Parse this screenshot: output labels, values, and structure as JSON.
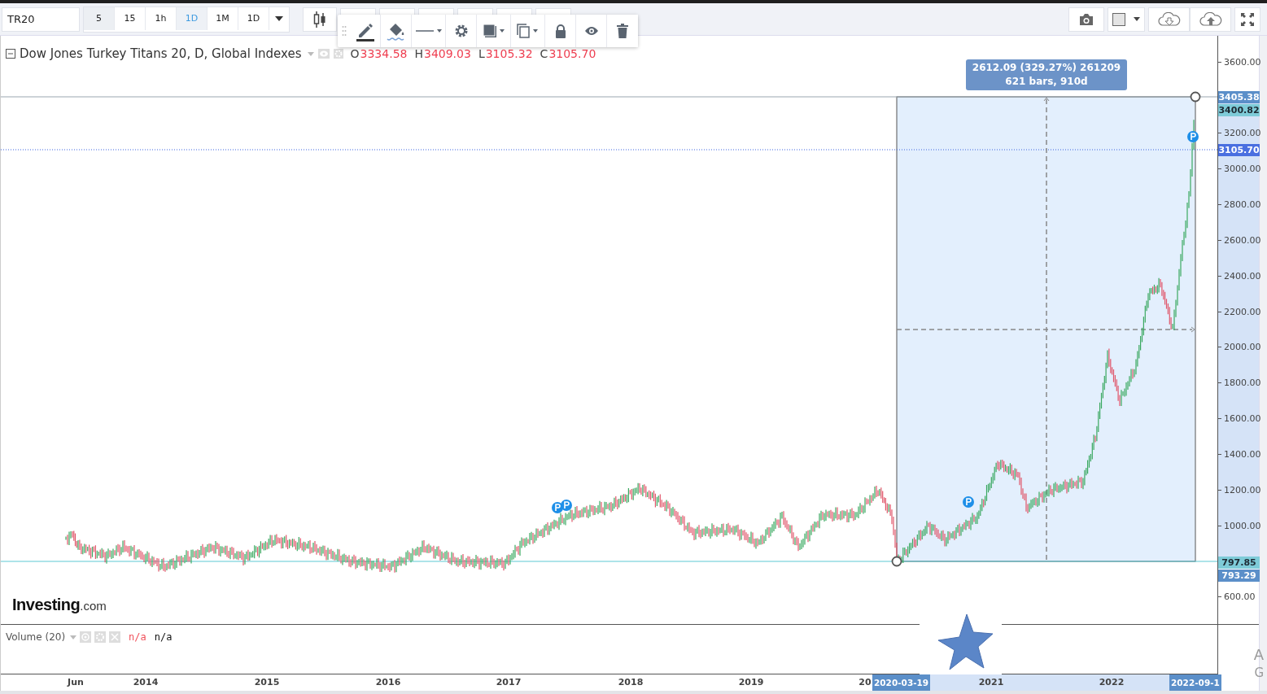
{
  "symbol": {
    "value": "TR20"
  },
  "intervals": [
    {
      "label": "5",
      "selected": false,
      "highlighted": true
    },
    {
      "label": "15",
      "selected": false,
      "highlighted": false
    },
    {
      "label": "1h",
      "selected": false,
      "highlighted": false
    },
    {
      "label": "1D",
      "selected": true,
      "highlighted": false
    },
    {
      "label": "1M",
      "selected": false,
      "highlighted": false
    },
    {
      "label": "1D",
      "selected": false,
      "highlighted": false
    }
  ],
  "legend": {
    "title": "Dow Jones Turkey Titans 20, D, Global Indexes",
    "ohlc": [
      {
        "label": "O",
        "value": "3334.58"
      },
      {
        "label": "H",
        "value": "3409.03"
      },
      {
        "label": "L",
        "value": "3105.32"
      },
      {
        "label": "C",
        "value": "3105.70"
      }
    ]
  },
  "measure": {
    "lines": [
      "2612.09 (329.27%) 261209",
      "621 bars, 910d"
    ]
  },
  "price_axis": {
    "ticks": [
      "3600.00",
      "3200.00",
      "3000.00",
      "2800.00",
      "2600.00",
      "2400.00",
      "2200.00",
      "2000.00",
      "1800.00",
      "1600.00",
      "1400.00",
      "1200.00",
      "1000.00",
      "600.00"
    ],
    "badges": [
      {
        "value": "3405.38",
        "color": "#5b8fc9"
      },
      {
        "value": "3400.82",
        "color": "#7ecbd8"
      },
      {
        "value": "3105.70",
        "color": "#4a6fe0"
      },
      {
        "value": "797.85",
        "color": "#7ecbd8"
      },
      {
        "value": "793.29",
        "color": "#5b8fc9"
      }
    ]
  },
  "logo": {
    "name": "Investing",
    "suffix": ".com"
  },
  "volume": {
    "title": "Volume (20)",
    "values": [
      {
        "text": "n/a",
        "kind": "down"
      },
      {
        "text": "n/a",
        "kind": "plain"
      }
    ]
  },
  "time_axis": {
    "ticks": [
      "Jun",
      "2014",
      "2015",
      "2016",
      "2017",
      "2018",
      "2019",
      "20",
      "2021",
      "2022"
    ],
    "badges": [
      "2020-03-19",
      "2022-09-1"
    ]
  },
  "os_overlay": [
    "A",
    "G"
  ]
}
